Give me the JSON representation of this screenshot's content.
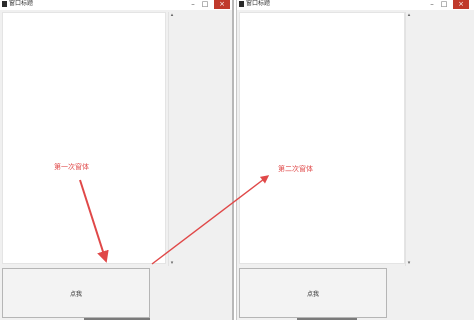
{
  "window1": {
    "title": "窗口标题",
    "button_label": "点我"
  },
  "window2": {
    "title": "窗口标题",
    "button_label": "点我"
  },
  "annotations": {
    "first": "第一次窗体",
    "second": "第二次窗体"
  },
  "controls": {
    "minimize": "–",
    "maximize": "□",
    "close": "×"
  },
  "colors": {
    "annotation": "#e04848",
    "close_button": "#c0392b"
  }
}
